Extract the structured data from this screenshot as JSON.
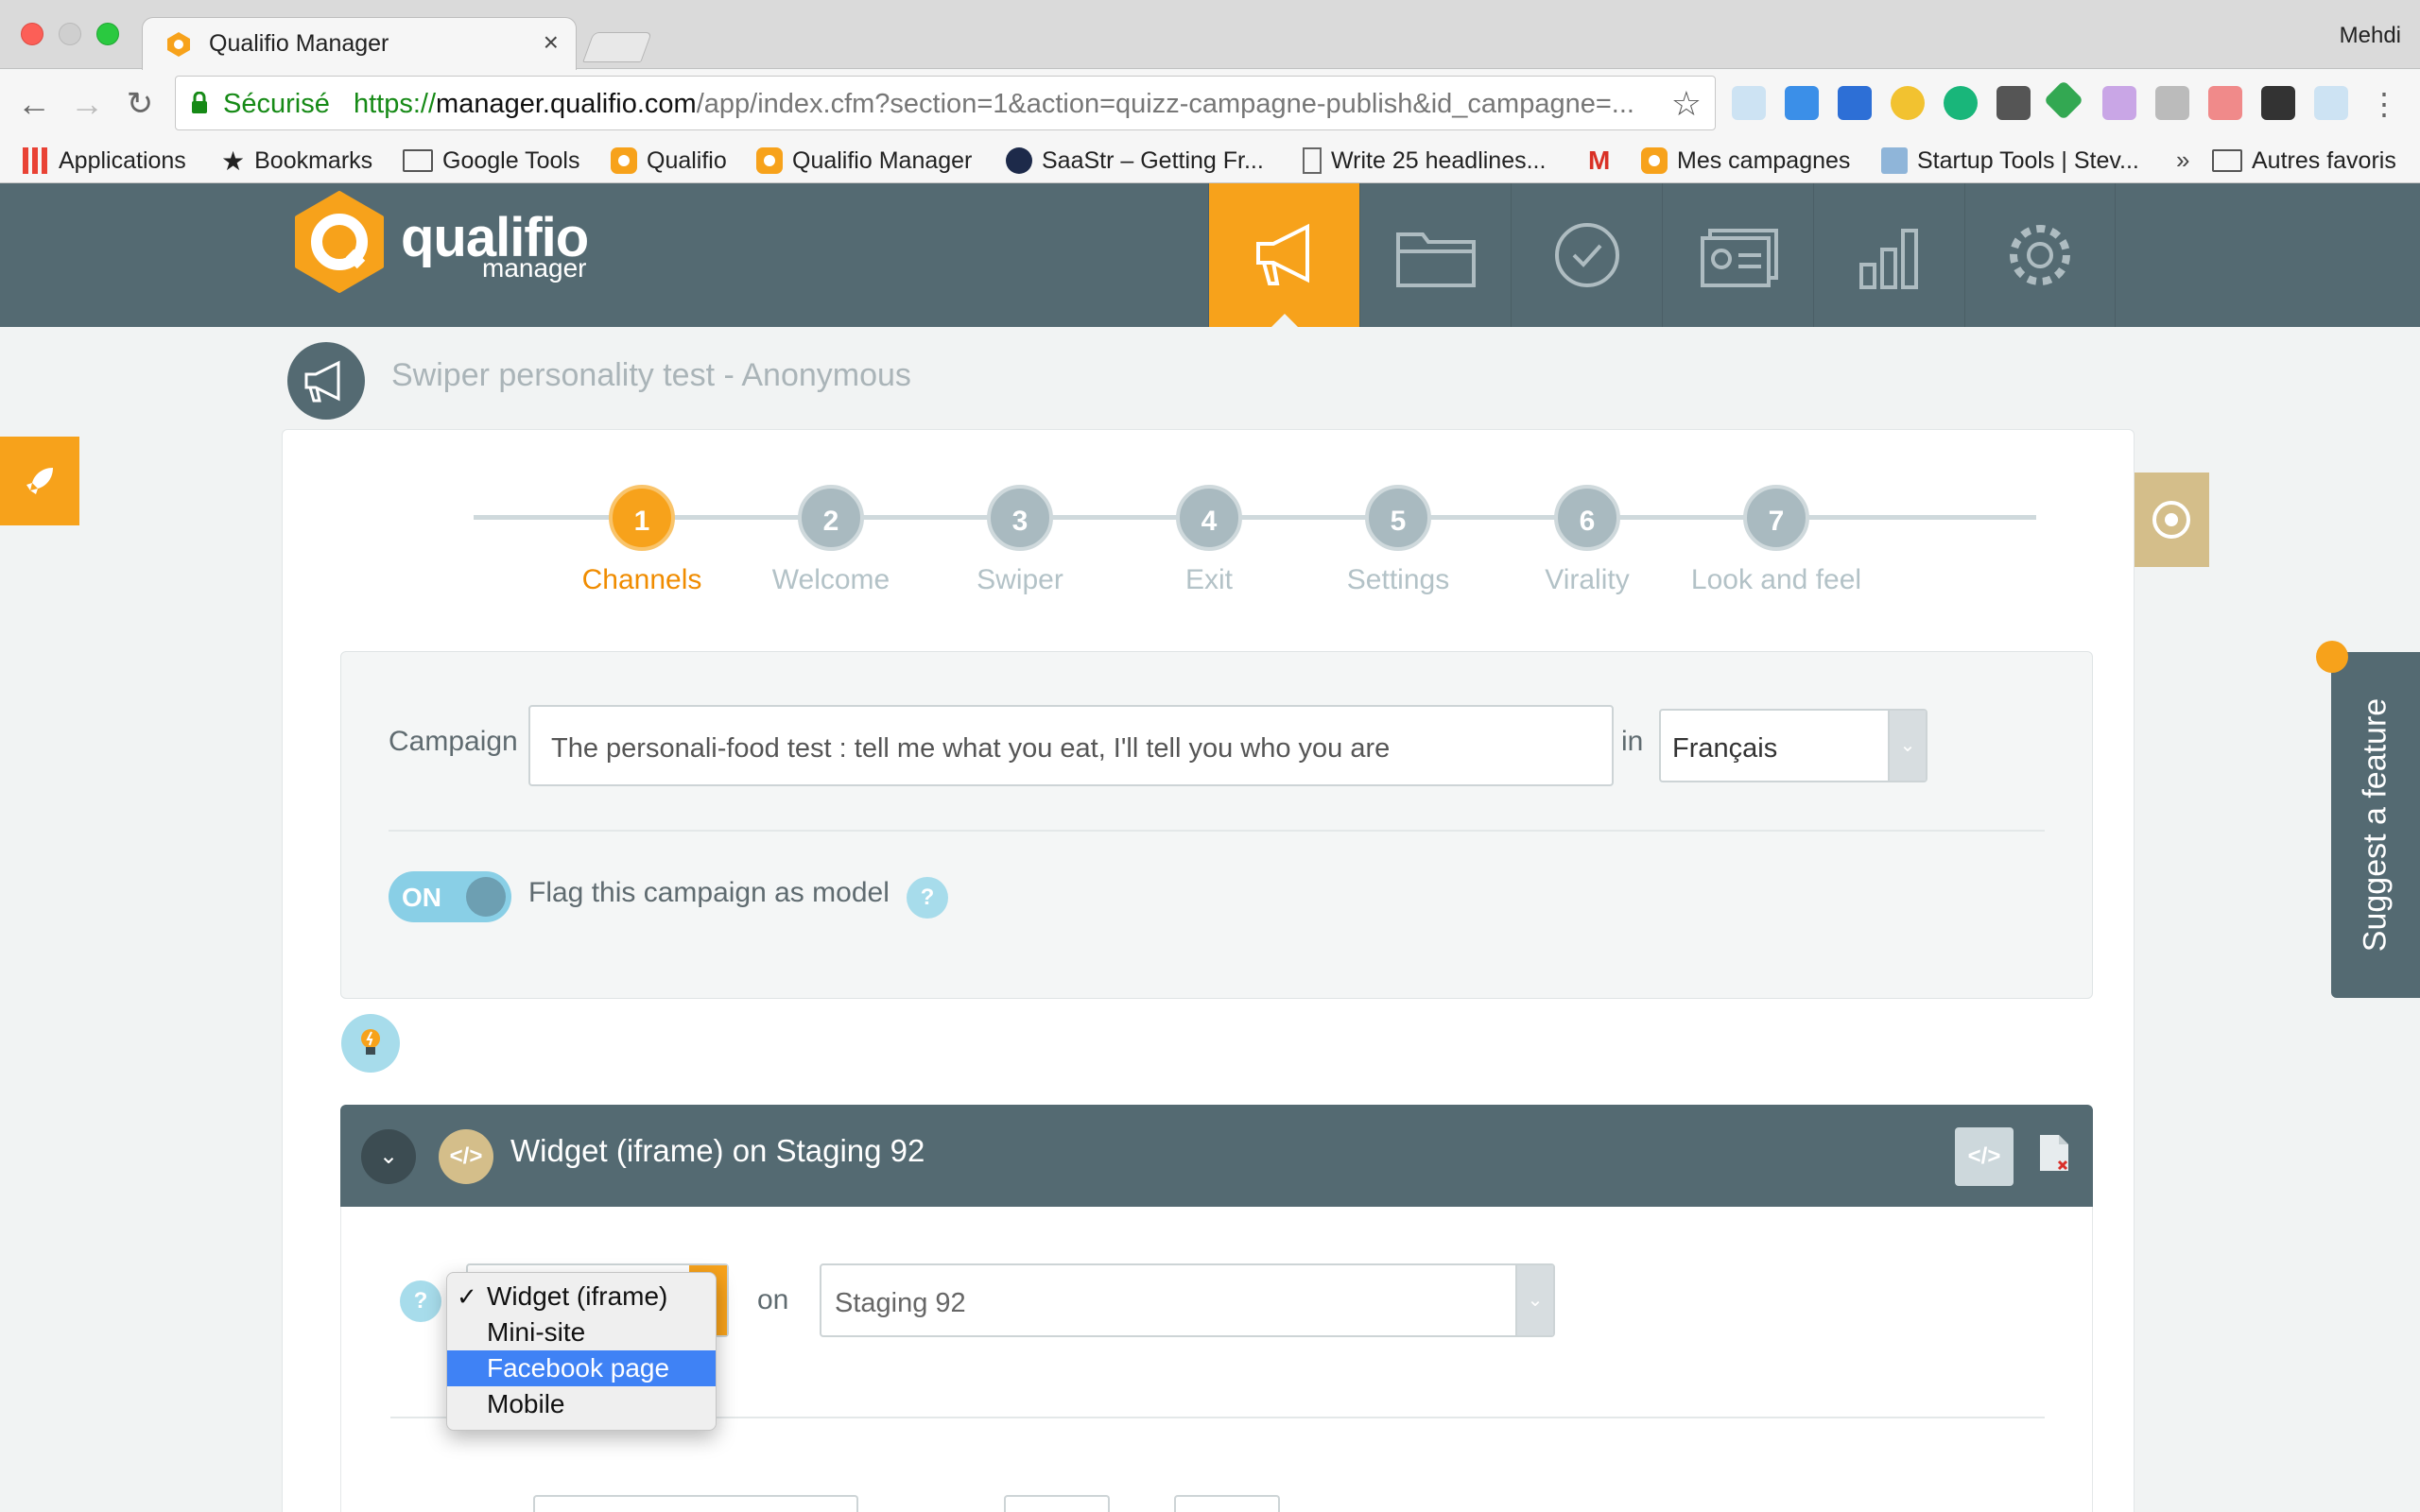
{
  "browser": {
    "tab_title": "Qualifio Manager",
    "tab_close": "×",
    "profile": "Mehdi",
    "secure_label": "Sécurisé",
    "url_protocol": "https://",
    "url_host": "manager.qualifio.com",
    "url_path": "/app/index.cfm?section=1&action=quizz-campagne-publish&id_campagne=...",
    "bookmarks": [
      "Applications",
      "Bookmarks",
      "Google Tools",
      "Qualifio",
      "Qualifio Manager",
      "SaaStr – Getting Fr...",
      "Write 25 headlines...",
      "Mes campagnes",
      "Startup Tools | Stev..."
    ],
    "overflow": "»",
    "other_bookmarks": "Autres favoris"
  },
  "app": {
    "logo_text": "qualifio",
    "logo_sub": "manager",
    "accent": "#f7a21b",
    "header_color": "#546a72",
    "nav": [
      "megaphone-icon",
      "folder-icon",
      "check-icon",
      "contacts-icon",
      "stats-icon",
      "settings-icon"
    ]
  },
  "page": {
    "title": "Swiper personality test - Anonymous",
    "steps": [
      {
        "num": "1",
        "label": "Channels",
        "active": true
      },
      {
        "num": "2",
        "label": "Welcome"
      },
      {
        "num": "3",
        "label": "Swiper"
      },
      {
        "num": "4",
        "label": "Exit"
      },
      {
        "num": "5",
        "label": "Settings"
      },
      {
        "num": "6",
        "label": "Virality"
      },
      {
        "num": "7",
        "label": "Look and feel"
      }
    ],
    "campaign_label": "Campaign",
    "campaign_value": "The personali-food test : tell me what you eat, I'll tell you who you are",
    "in_label": "in",
    "language": "Français",
    "toggle_state": "ON",
    "flag_label": "Flag this campaign as model",
    "help_glyph": "?",
    "suggest_feature": "Suggest a feature"
  },
  "widget": {
    "title": "Widget (iframe) on Staging 92",
    "code_glyph": "</>",
    "on_label": "on",
    "site_value": "Staging 92",
    "type_options": [
      {
        "label": "Widget (iframe)",
        "checked": true
      },
      {
        "label": "Mini-site"
      },
      {
        "label": "Facebook page",
        "highlighted": true
      },
      {
        "label": "Mobile"
      }
    ],
    "check_glyph": "✓"
  }
}
